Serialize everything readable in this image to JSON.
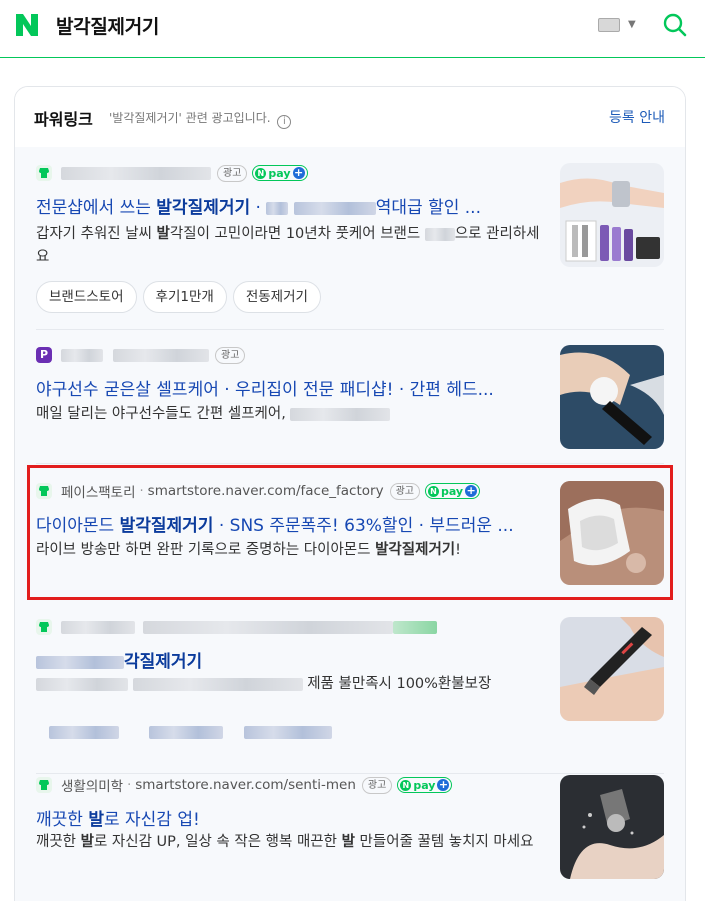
{
  "header": {
    "logo": "N",
    "query": "발각질제거기",
    "icons": {
      "keyboard": "keyboard-icon",
      "dropdown": "chevron-down-icon",
      "search": "search-icon"
    }
  },
  "powerlink": {
    "title": "파워링크",
    "note": "'발각질제거기' 관련 광고입니다.",
    "info_icon": "i",
    "register_label": "등록 안내"
  },
  "labels": {
    "ad_badge": "광고",
    "npay_n": "N",
    "npay_text": "pay",
    "npay_plus": "+"
  },
  "ads": [
    {
      "shop_name": "",
      "shop_url": "",
      "favicon": "naver-store-icon",
      "npay": true,
      "headline_prefix": "전문샵에서 쓰는 ",
      "headline_bold": "발각질제거기",
      "headline_suffix": " · ",
      "headline_tail": "역대급 할인 ...",
      "description_1": "갑자기 추워진 날씨 ",
      "description_bold": "발",
      "description_2": "각질이 고민이라면 10년차 풋케어 브랜드 ",
      "description_3": "으로 관리하세요",
      "chips": [
        "브랜드스토어",
        "후기1만개",
        "전동제거기"
      ]
    },
    {
      "shop_name": "",
      "shop_url": "",
      "favicon": "P",
      "npay": false,
      "headline": "야구선수 굳은살 셀프케어 · 우리집이 전문 패디샵! · 간편 헤드...",
      "description": "매일 달리는 야구선수들도 간편 셀프케어, "
    },
    {
      "shop_name": "페이스팩토리",
      "shop_url": "smartstore.naver.com/face_factory",
      "favicon": "naver-store-icon",
      "npay": true,
      "headline_prefix": "다이아몬드 ",
      "headline_bold": "발각질제거기",
      "headline_suffix": " · SNS 주문폭주! 63%할인 · 부드러운 ...",
      "description_1": "라이브 방송만 하면 완판 기록으로 증명하는 다이아몬드 ",
      "description_bold": "발각질제거기",
      "description_2": "!"
    },
    {
      "shop_name": "",
      "shop_url": "",
      "favicon": "naver-store-icon",
      "npay": false,
      "headline_bold": "각질제거기",
      "description_tail": "제품 불만족시 100%환불보장"
    },
    {
      "shop_name": "생활의미학",
      "shop_url": "smartstore.naver.com/senti-men",
      "favicon": "naver-store-icon",
      "npay": true,
      "headline_prefix": "깨끗한 ",
      "headline_bold": "발",
      "headline_suffix": "로 자신감 업!",
      "description_1": "깨끗한 ",
      "description_bold_1": "발",
      "description_2": "로 자신감 UP, 일상 속 작은 행복 매끈한 ",
      "description_bold_2": "발",
      "description_3": " 만들어줄 꿀템 놓치지 마세요"
    }
  ],
  "colors": {
    "naver_green": "#03c75a",
    "link_blue": "#1748b3",
    "highlight_red": "#e21d1d",
    "npay_plus_blue": "#1f6cd8"
  }
}
